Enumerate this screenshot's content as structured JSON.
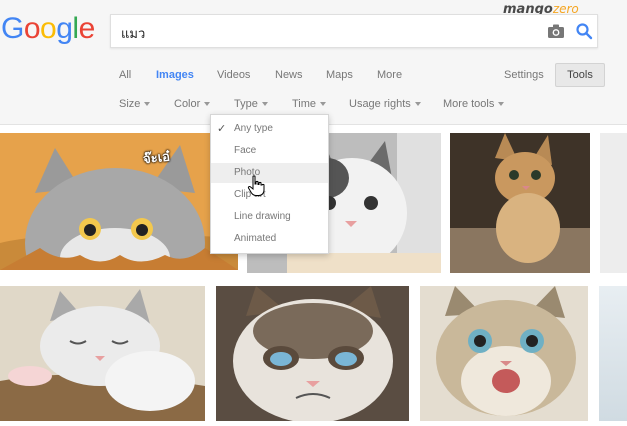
{
  "logo": {
    "letters": [
      "G",
      "o",
      "o",
      "g",
      "l",
      "e"
    ],
    "colors": [
      "#4285f4",
      "#ea4335",
      "#fbbc05",
      "#4285f4",
      "#34a853",
      "#ea4335"
    ]
  },
  "watermark": {
    "part1": "mango",
    "part2": "zero"
  },
  "search": {
    "value": "แมว",
    "icons": [
      "camera-icon",
      "search-icon"
    ]
  },
  "tabs": [
    {
      "label": "All",
      "active": false
    },
    {
      "label": "Images",
      "active": true
    },
    {
      "label": "Videos",
      "active": false
    },
    {
      "label": "News",
      "active": false
    },
    {
      "label": "Maps",
      "active": false
    },
    {
      "label": "More",
      "active": false
    }
  ],
  "settings_label": "Settings",
  "tools_label": "Tools",
  "filters": [
    "Size",
    "Color",
    "Type",
    "Time",
    "Usage rights",
    "More tools"
  ],
  "type_menu": {
    "items": [
      "Any type",
      "Face",
      "Photo",
      "Clip art",
      "Line drawing",
      "Animated"
    ],
    "selected": "Any type",
    "hovered": "Photo"
  },
  "image_caption": "จ๊ะเอ๋",
  "colors": {
    "accent": "#4285f4",
    "header_bg": "#f6f6f6"
  }
}
